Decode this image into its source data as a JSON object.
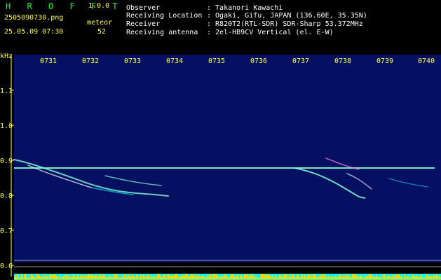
{
  "app": {
    "name": "H R O F F T",
    "version": "1.0.0"
  },
  "file": {
    "name": "2505090730.png",
    "datetime": "25.05.09 07:30"
  },
  "meteor": {
    "label": "meteor",
    "count": "52"
  },
  "info": [
    {
      "key": "Observer",
      "value": ": Takanori Kawachi"
    },
    {
      "key": "Receiving Location",
      "value": ": Ogaki, Gifu, JAPAN (136.60E, 35.35N)"
    },
    {
      "key": "Receiver",
      "value": ": R820T2(RTL-SDR) SDR-Sharp 53.372MHz"
    },
    {
      "key": "Receiving antenna",
      "value": ": 2el-HB9CV Vertical (el. E-W)"
    }
  ],
  "axis": {
    "unit": "kHz",
    "x_ticks": [
      "0731",
      "0732",
      "0733",
      "0734",
      "0735",
      "0736",
      "0737",
      "0738",
      "0739",
      "0740"
    ],
    "y_ticks": [
      "1.1",
      "1.0",
      "0.9",
      "0.8",
      "0.7",
      "0.6"
    ]
  },
  "colors": {
    "background": "#061062",
    "label": "#ffff3c",
    "brand": "#19ff19",
    "carrier": "#7fffd4",
    "amplitude": "#ffe100",
    "baseline": "#00ffff"
  }
}
